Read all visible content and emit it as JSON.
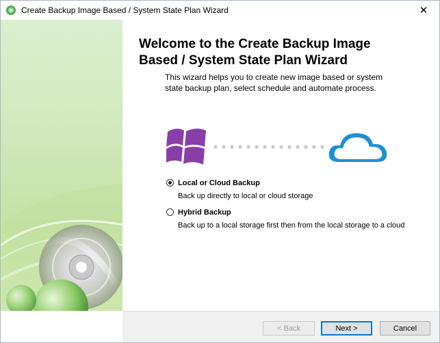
{
  "window": {
    "title": "Create Backup Image Based / System State Plan Wizard",
    "close_label": "✕"
  },
  "welcome": {
    "headline_line1": "Welcome to the Create Backup Image",
    "headline_line2": "Based / System State Plan Wizard",
    "intro": "This wizard helps you to create new image based or system state backup plan, select schedule and automate process."
  },
  "options": [
    {
      "label": "Local or Cloud Backup",
      "description": "Back up directly to local or cloud storage",
      "selected": true
    },
    {
      "label": "Hybrid Backup",
      "description": "Back up to a local storage first then from the local storage to a cloud",
      "selected": false
    }
  ],
  "buttons": {
    "back": "< Back",
    "next": "Next >",
    "cancel": "Cancel"
  },
  "colors": {
    "windows_logo": "#8a3fa8",
    "cloud": "#1e8fd4",
    "sidebar_green": "#c8e3a8",
    "accent": "#0078d7"
  }
}
